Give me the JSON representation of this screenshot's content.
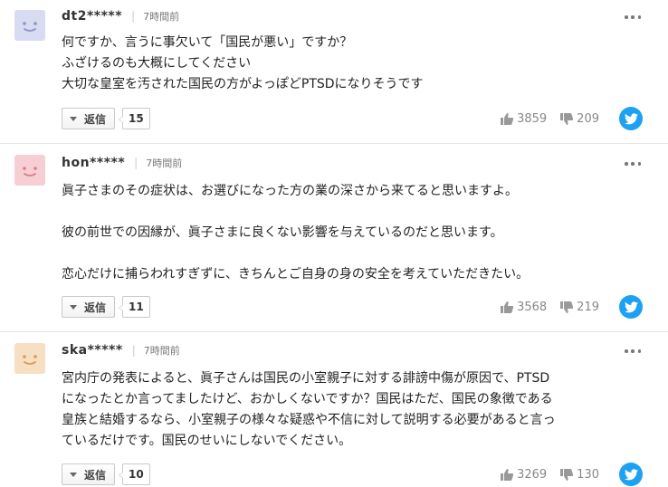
{
  "comments": [
    {
      "username": "dt2*****",
      "time": "7時間前",
      "avatar_color": "#d8dcf2",
      "avatar_feature": "#8a93c8",
      "lines": [
        "何ですか、言うに事欠いて「国民が悪い」ですか？",
        "ふざけるのも大概にしてください",
        "大切な皇室を汚された国民の方がよっぽどPTSDになりそうです"
      ],
      "reply_label": "返信",
      "reply_count": "15",
      "likes": "3859",
      "dislikes": "209"
    },
    {
      "username": "hon*****",
      "time": "7時間前",
      "avatar_color": "#f6cfd4",
      "avatar_feature": "#e07a88",
      "lines": [
        "眞子さまのその症状は、お選びになった方の業の深さから来てると思いますよ。",
        "",
        "彼の前世での因縁が、眞子さまに良くない影響を与えているのだと思います。",
        "",
        "恋心だけに捕らわれすぎずに、きちんとご自身の身の安全を考えていただきたい。"
      ],
      "reply_label": "返信",
      "reply_count": "11",
      "likes": "3568",
      "dislikes": "219"
    },
    {
      "username": "ska*****",
      "time": "7時間前",
      "avatar_color": "#f7dfc3",
      "avatar_feature": "#d99a55",
      "lines": [
        "宮内庁の発表によると、眞子さんは国民の小室親子に対する誹謗中傷が原因で、PTSD",
        "になったとか言ってましたけど、おかしくないですか？国民はただ、国民の象徴である",
        "皇族と結婚するなら、小室親子の様々な疑惑や不信に対して説明する必要があると言っ",
        "ているだけです。国民のせいにしないでください。"
      ],
      "reply_label": "返信",
      "reply_count": "10",
      "likes": "3269",
      "dislikes": "130"
    }
  ],
  "icons": {
    "more": "more-dots-icon",
    "like": "thumbs-up-icon",
    "dislike": "thumbs-down-icon",
    "twitter": "twitter-bird-icon",
    "reply_toggle": "triangle-down-icon"
  },
  "colors": {
    "twitter": "#1da1f2",
    "vote_text": "#888888",
    "divider": "#e6e6e6"
  }
}
